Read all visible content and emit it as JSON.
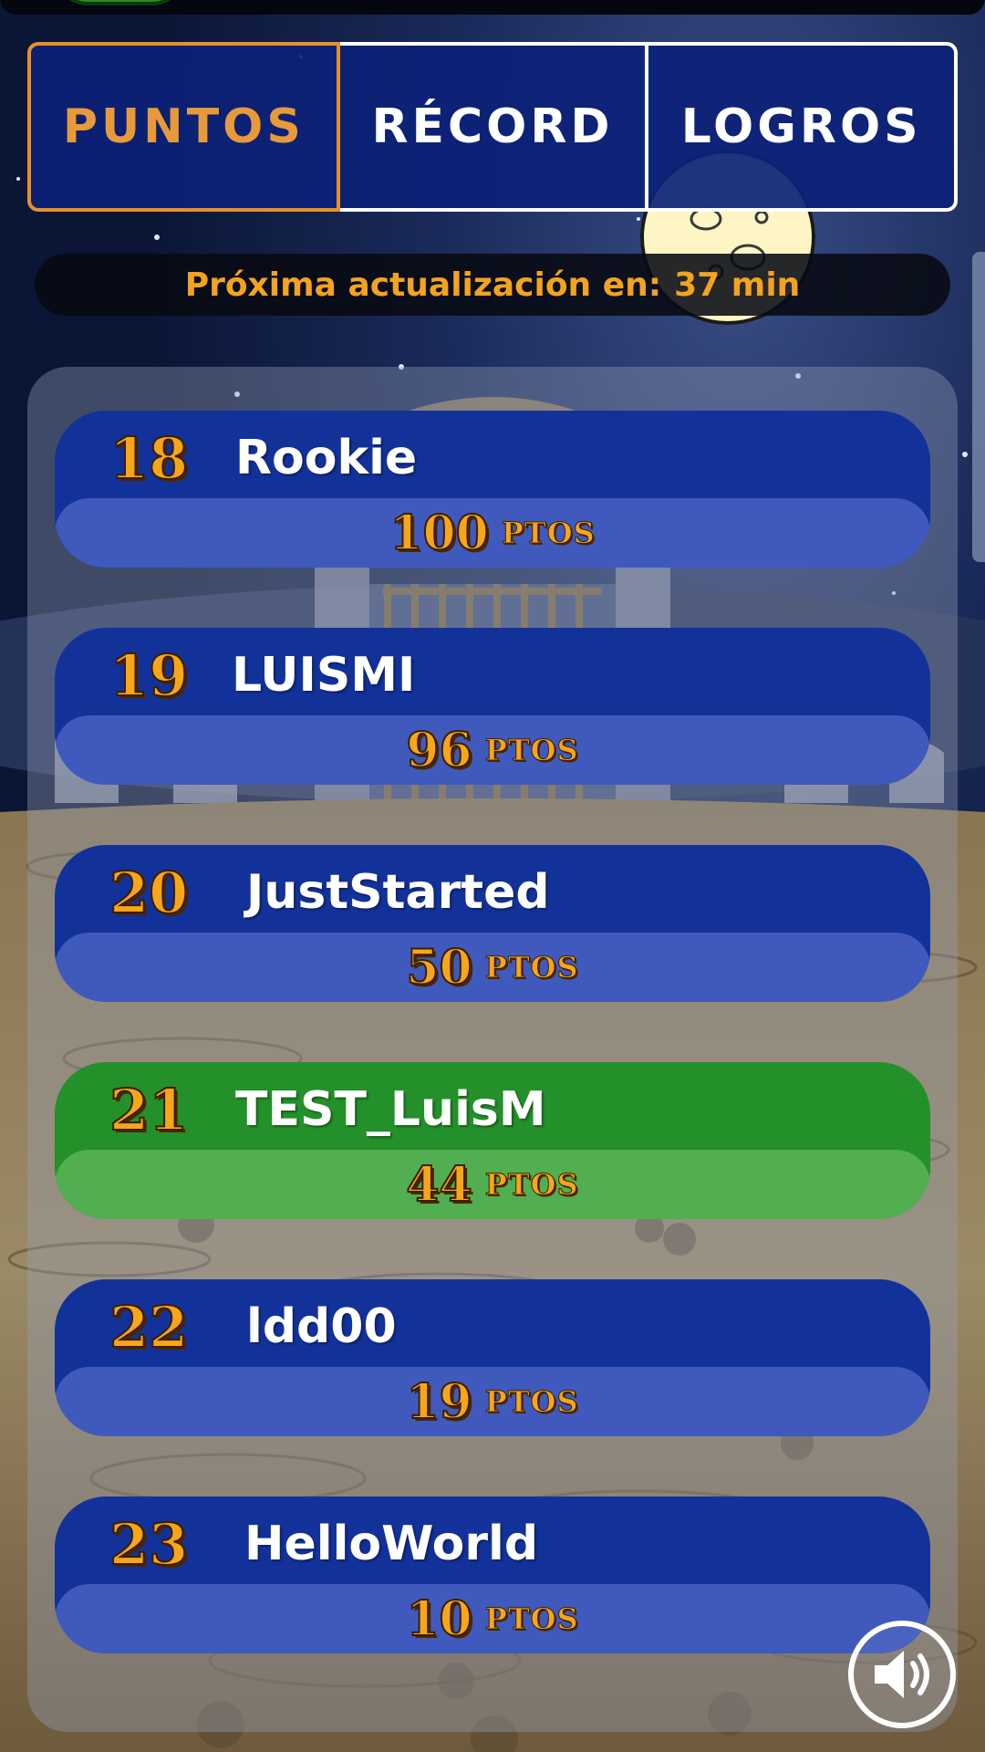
{
  "tabs": [
    {
      "label": "PUNTOS",
      "active": true
    },
    {
      "label": "RÉCORD",
      "active": false
    },
    {
      "label": "LOGROS",
      "active": false
    }
  ],
  "update": {
    "prefix": "Próxima actualización en:",
    "value": "37 min"
  },
  "points_unit": "PTOS",
  "ranking": [
    {
      "rank": "18",
      "name": "Rookie",
      "points": "100",
      "current_user": false
    },
    {
      "rank": "19",
      "name": "LUISMI",
      "points": "96",
      "current_user": false
    },
    {
      "rank": "20",
      "name": "JustStarted",
      "points": "50",
      "current_user": false
    },
    {
      "rank": "21",
      "name": "TEST_LuisM",
      "points": "44",
      "current_user": true
    },
    {
      "rank": "22",
      "name": "ldd00",
      "points": "19",
      "current_user": false
    },
    {
      "rank": "23",
      "name": "HelloWorld",
      "points": "10",
      "current_user": false
    }
  ],
  "sound_icon": "speaker-icon",
  "colors": {
    "accent_orange": "#f7a51a",
    "tab_active_border": "#e8902a",
    "entry_blue": "#12329a",
    "entry_green": "#23902a",
    "sky": "#0d1a3d"
  }
}
